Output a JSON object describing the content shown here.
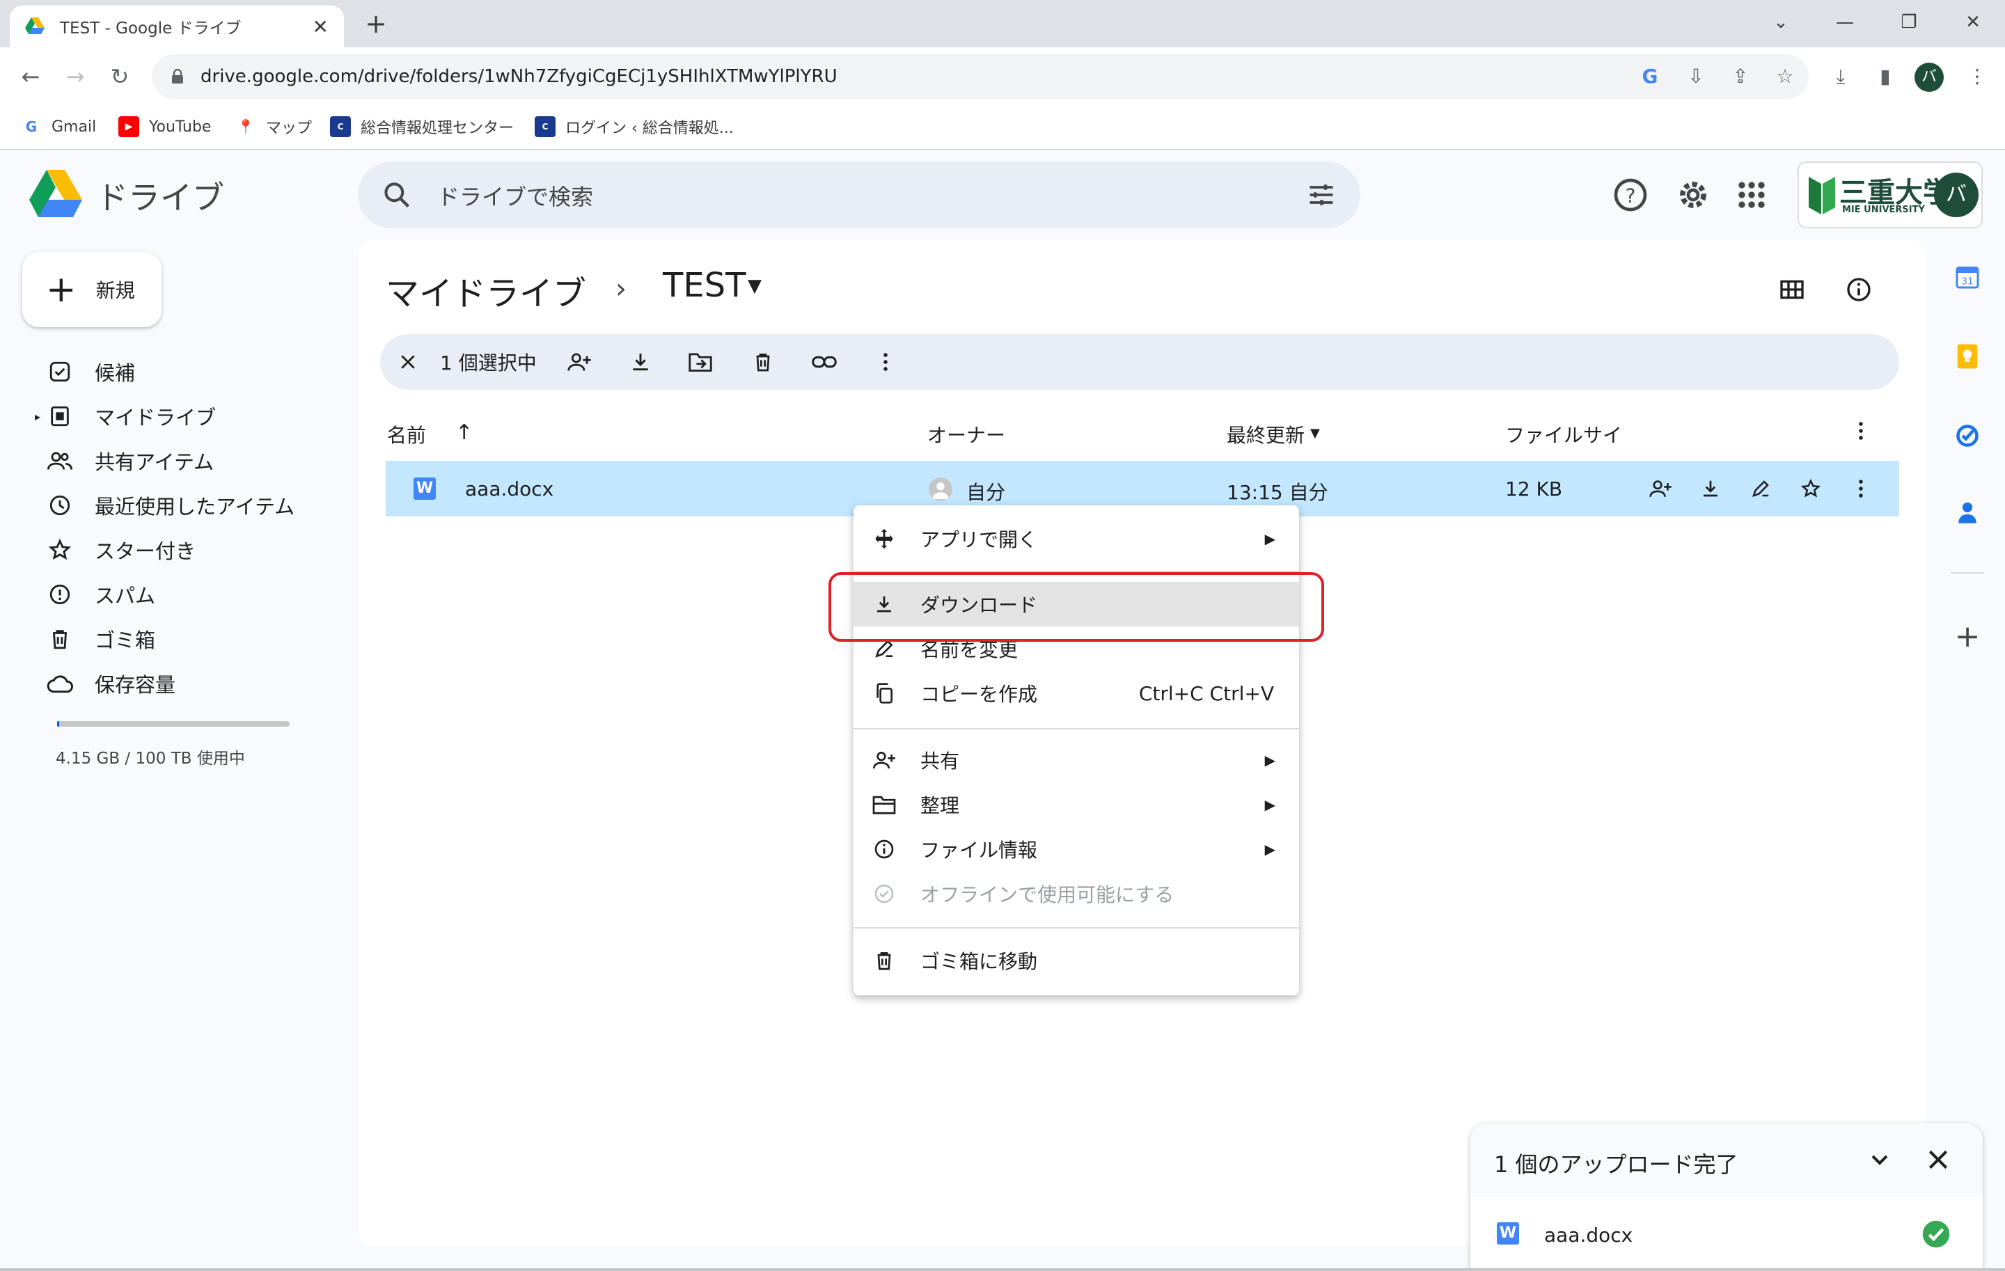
{
  "browser": {
    "tab_title": "TEST - Google ドライブ",
    "url": "drive.google.com/drive/folders/1wNh7ZfygiCgECj1ySHIhlXTMwYlPlYRU",
    "profile_initial": "バ",
    "bookmarks": [
      {
        "label": "Gmail"
      },
      {
        "label": "YouTube"
      },
      {
        "label": "マップ"
      },
      {
        "label": "総合情報処理センター"
      },
      {
        "label": "ログイン ‹ 総合情報処..."
      }
    ]
  },
  "drive": {
    "app_name": "ドライブ",
    "search_placeholder": "ドライブで検索",
    "new_button": "新規",
    "account_initial": "バ",
    "org_logo_text": "三重大学",
    "org_logo_sub": "MIE UNIVERSITY",
    "nav": [
      {
        "label": "候補",
        "icon": "suggested-icon"
      },
      {
        "label": "マイドライブ",
        "icon": "my-drive-icon"
      },
      {
        "label": "共有アイテム",
        "icon": "shared-icon"
      },
      {
        "label": "最近使用したアイテム",
        "icon": "recent-icon"
      },
      {
        "label": "スター付き",
        "icon": "star-icon"
      },
      {
        "label": "スパム",
        "icon": "spam-icon"
      },
      {
        "label": "ゴミ箱",
        "icon": "trash-icon"
      },
      {
        "label": "保存容量",
        "icon": "cloud-icon"
      }
    ],
    "storage": {
      "text": "4.15 GB / 100 TB 使用中",
      "used_fraction": 4e-05
    },
    "breadcrumb": {
      "root": "マイドライブ",
      "current": "TEST"
    },
    "selection": {
      "count_label": "1 個選択中"
    },
    "columns": {
      "name": "名前",
      "owner": "オーナー",
      "modified": "最終更新",
      "size": "ファイルサイ"
    },
    "rows": [
      {
        "name": "aaa.docx",
        "owner": "自分",
        "modified": "13:15 自分",
        "size": "12 KB",
        "selected": true
      }
    ],
    "context_menu": [
      {
        "label": "アプリで開く",
        "icon": "open-with-icon",
        "submenu": true
      },
      {
        "label": "ダウンロード",
        "icon": "download-icon",
        "highlighted": true
      },
      {
        "label": "名前を変更",
        "icon": "rename-icon"
      },
      {
        "label": "コピーを作成",
        "icon": "copy-icon",
        "shortcut": "Ctrl+C Ctrl+V"
      },
      {
        "label": "共有",
        "icon": "share-icon",
        "submenu": true
      },
      {
        "label": "整理",
        "icon": "organize-icon",
        "submenu": true
      },
      {
        "label": "ファイル情報",
        "icon": "info-icon",
        "submenu": true
      },
      {
        "label": "オフラインで使用可能にする",
        "icon": "offline-icon",
        "disabled": true
      },
      {
        "label": "ゴミ箱に移動",
        "icon": "trash-icon"
      }
    ],
    "upload_panel": {
      "title": "1 個のアップロード完了",
      "file": "aaa.docx",
      "status": "complete"
    },
    "colors": {
      "accent": "#0b57d0",
      "selection": "#c2e7ff",
      "highlight_box": "#e0202a",
      "success": "#34a853"
    }
  }
}
